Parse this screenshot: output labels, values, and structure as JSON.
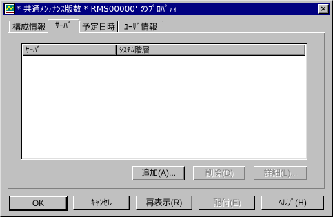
{
  "window": {
    "title": "* 共通ﾒﾝﾃﾅﾝｽ版数 * RMS00000' のﾌﾟﾛﾊﾟﾃｨ",
    "close_glyph": "×"
  },
  "tabs": [
    {
      "label": "構成情報"
    },
    {
      "label": "ｻｰﾊﾞ"
    },
    {
      "label": "予定日時"
    },
    {
      "label": "ﾕｰｻﾞ情報"
    }
  ],
  "listview": {
    "columns": [
      {
        "label": "ｻｰﾊﾞ"
      },
      {
        "label": "ｼｽﾃﾑ階層"
      }
    ],
    "rows": []
  },
  "panel_buttons": {
    "add": "追加(A)...",
    "delete": "削除(D)",
    "detail": "詳細(L)..."
  },
  "dialog_buttons": {
    "ok": "OK",
    "cancel": "ｷｬﾝｾﾙ",
    "refresh": "再表示(R)",
    "distribute": "配付(E)",
    "help": "ﾍﾙﾌﾟ(H)"
  }
}
